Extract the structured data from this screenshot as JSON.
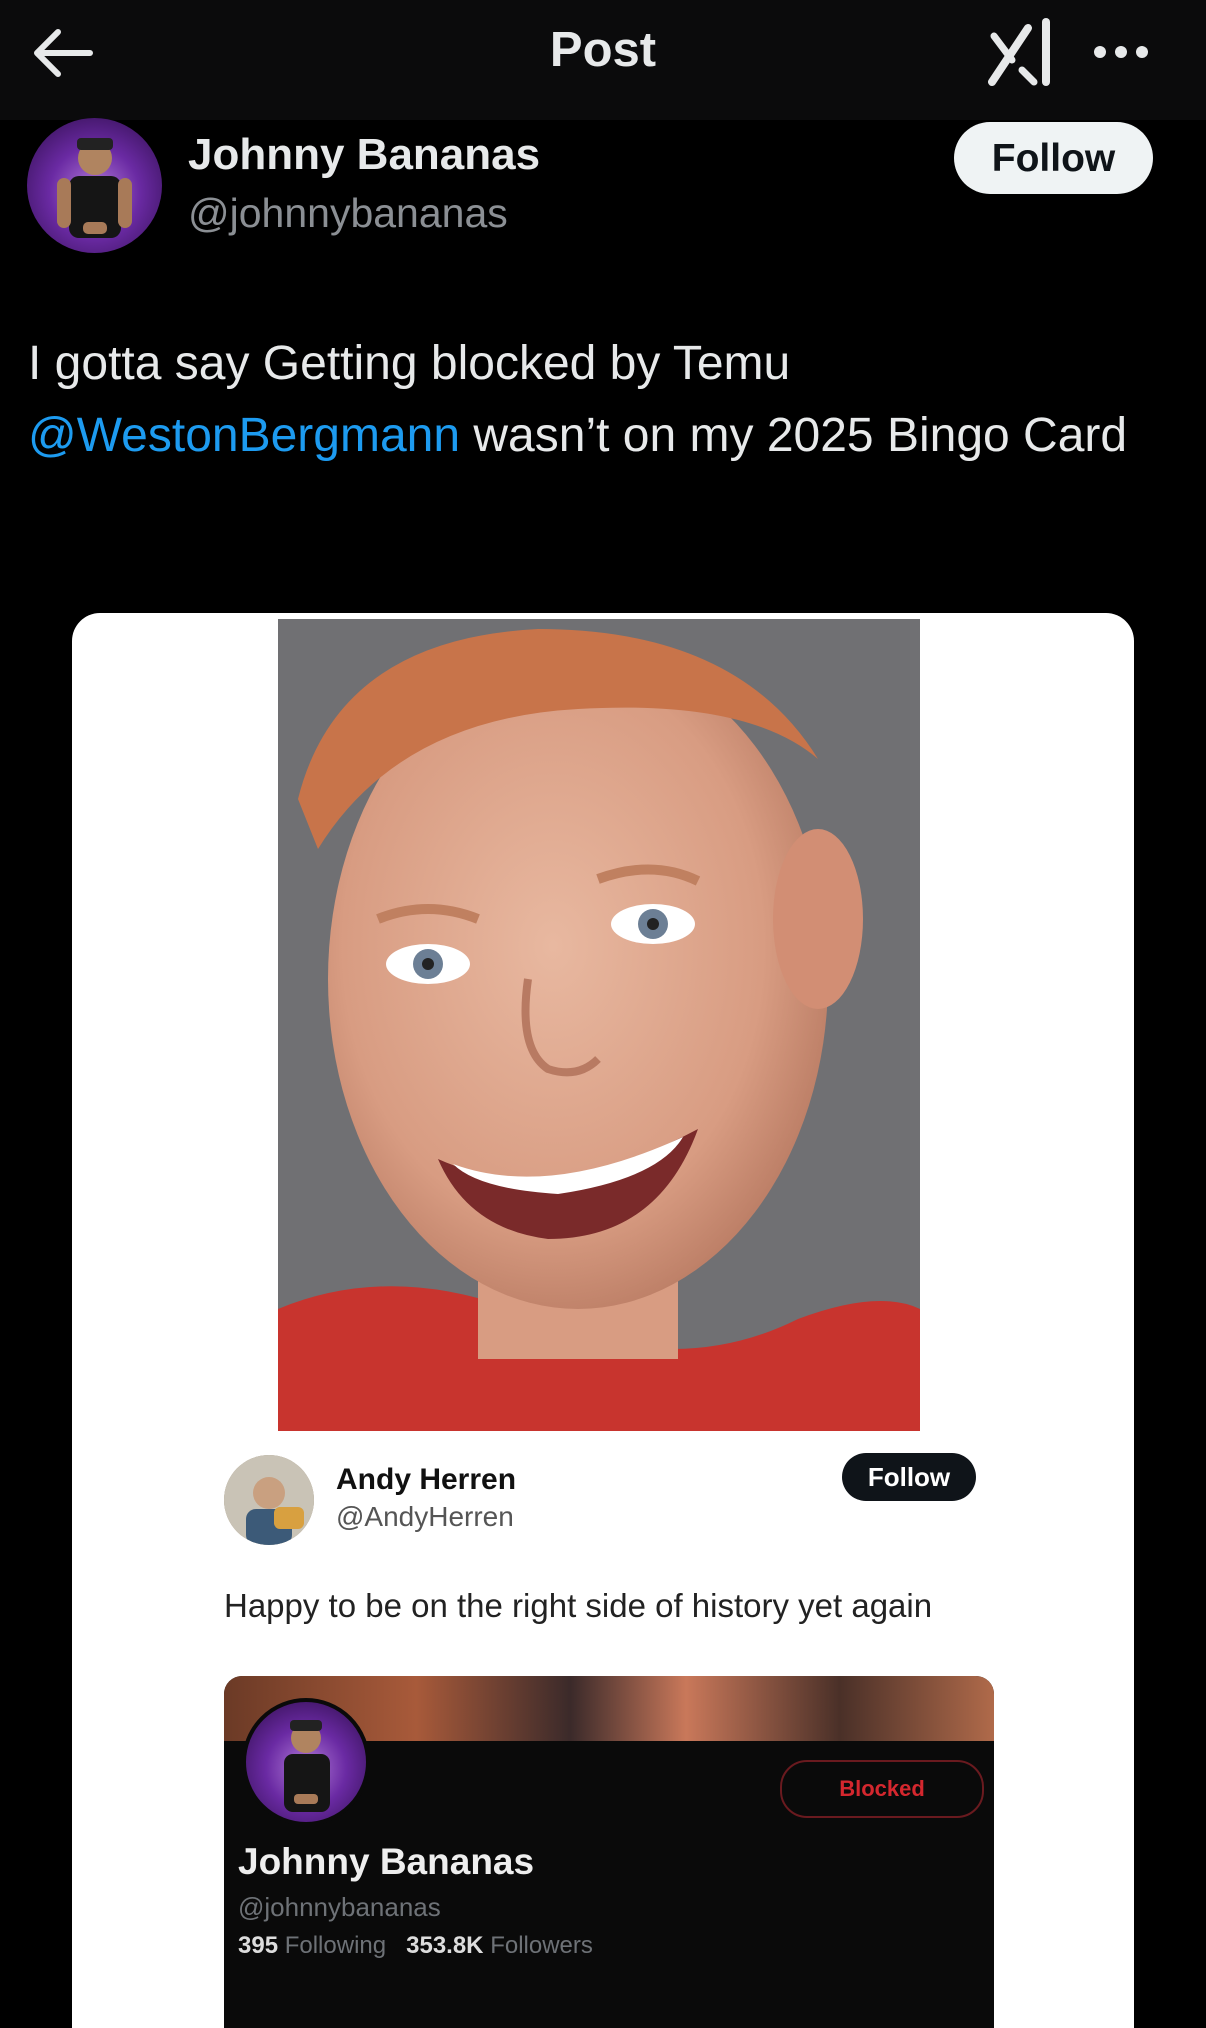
{
  "header": {
    "title": "Post",
    "icons": [
      "back-arrow-icon",
      "grok-icon",
      "more-options-icon"
    ]
  },
  "author": {
    "name": "Johnny Bananas",
    "handle": "@johnnybananas",
    "follow_label": "Follow"
  },
  "post": {
    "text_before": "I gotta say Getting blocked by Temu ",
    "mention": "@WestonBergmann",
    "text_after": " wasn’t on my 2025 Bingo Card"
  },
  "embedded": {
    "author_name": "Andy Herren",
    "author_handle": "@AndyHerren",
    "follow_label": "Follow",
    "text": "Happy to be on the right side of history yet again",
    "profile": {
      "name": "Johnny Bananas",
      "handle": "@johnnybananas",
      "blocked_label": "Blocked",
      "following_count": "395",
      "following_label": "Following",
      "followers_count": "353.8K",
      "followers_label": "Followers"
    }
  },
  "colors": {
    "background": "#000000",
    "mention": "#1d9bf0",
    "blocked": "#d4272e"
  }
}
